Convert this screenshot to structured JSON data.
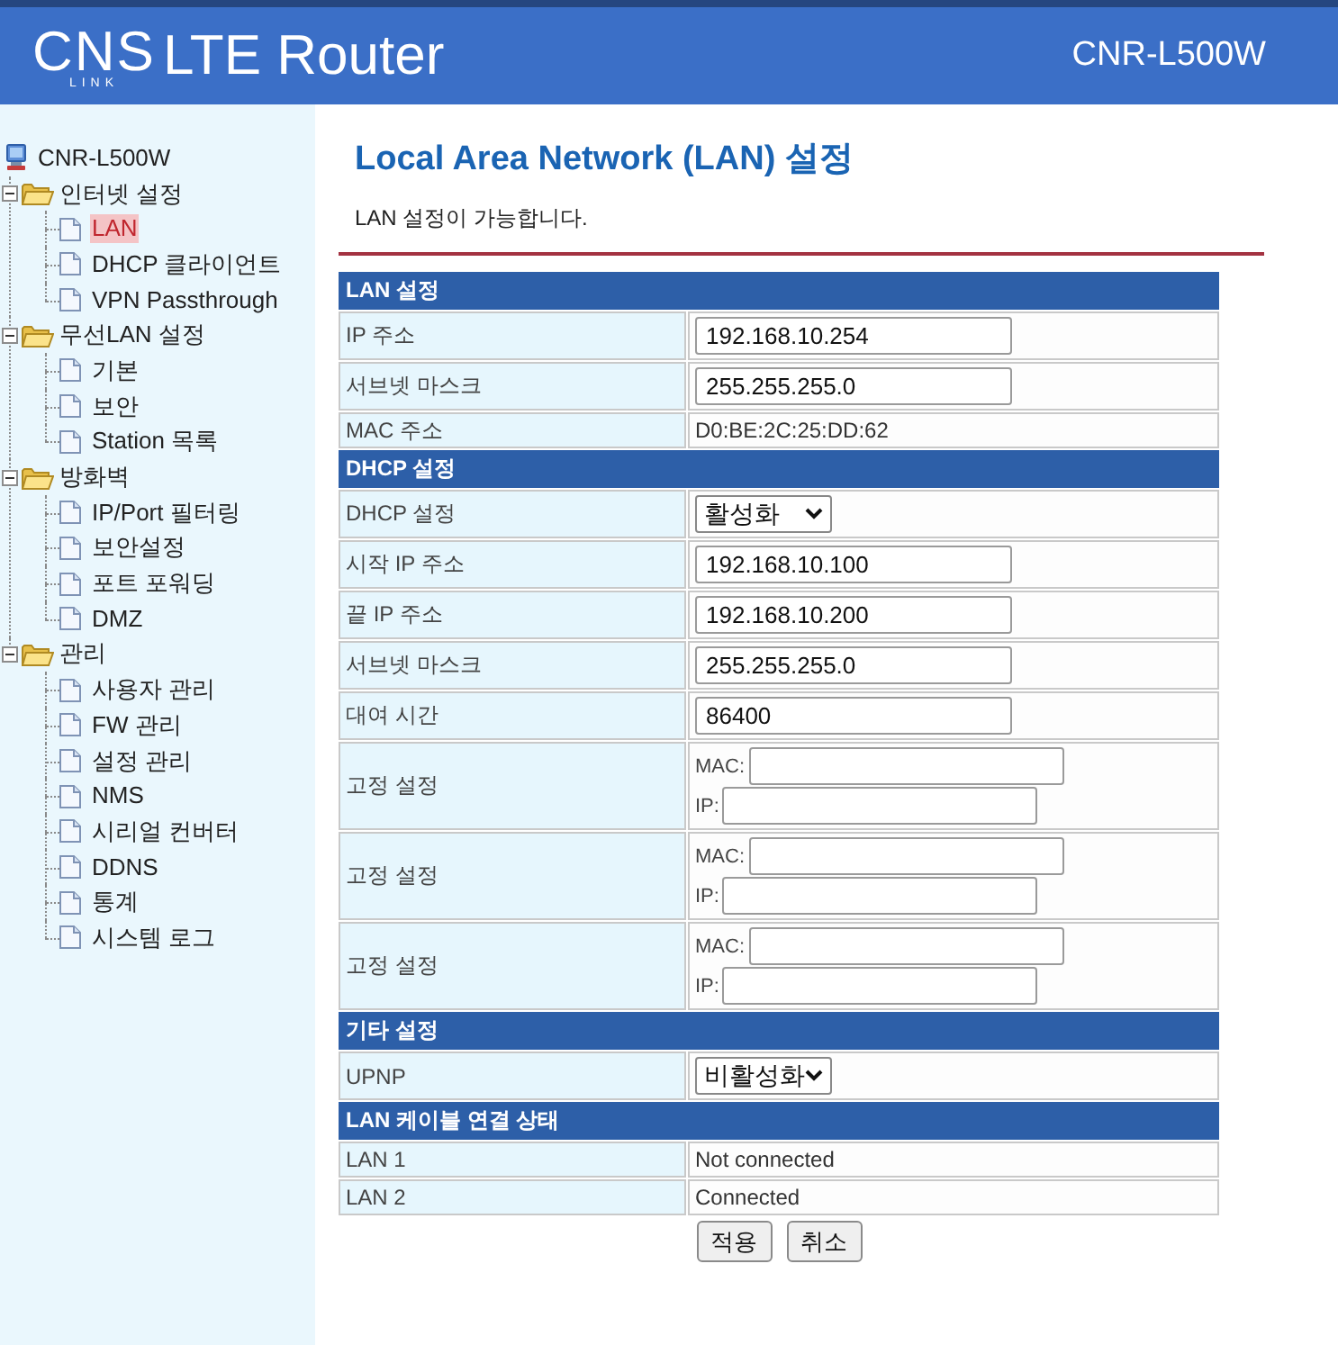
{
  "header": {
    "logo": {
      "letters": "CNS",
      "tagline": "LINK"
    },
    "title": "LTE Router",
    "model": "CNR-L500W"
  },
  "sidebar": {
    "root": {
      "label": "CNR-L500W",
      "selected": false
    },
    "items": [
      {
        "label": "인터넷 설정",
        "selected": false,
        "expanded": true,
        "children": [
          {
            "label": "LAN",
            "selected": true
          },
          {
            "label": "DHCP 클라이언트",
            "selected": false
          },
          {
            "label": "VPN Passthrough",
            "selected": false
          }
        ]
      },
      {
        "label": "무선LAN 설정",
        "selected": false,
        "expanded": true,
        "children": [
          {
            "label": "기본",
            "selected": false
          },
          {
            "label": "보안",
            "selected": false
          },
          {
            "label": "Station 목록",
            "selected": false
          }
        ]
      },
      {
        "label": "방화벽",
        "selected": false,
        "expanded": true,
        "children": [
          {
            "label": "IP/Port 필터링",
            "selected": false
          },
          {
            "label": "보안설정",
            "selected": false
          },
          {
            "label": "포트 포워딩",
            "selected": false
          },
          {
            "label": "DMZ",
            "selected": false
          }
        ]
      },
      {
        "label": "관리",
        "selected": false,
        "expanded": true,
        "children": [
          {
            "label": "사용자 관리",
            "selected": false
          },
          {
            "label": "FW 관리",
            "selected": false
          },
          {
            "label": "설정 관리",
            "selected": false
          },
          {
            "label": "NMS",
            "selected": false
          },
          {
            "label": "시리얼 컨버터",
            "selected": false
          },
          {
            "label": "DDNS",
            "selected": false
          },
          {
            "label": "통계",
            "selected": false
          },
          {
            "label": "시스템 로그",
            "selected": false
          }
        ]
      }
    ]
  },
  "page": {
    "title": "Local Area Network (LAN) 설정",
    "description": "LAN 설정이 가능합니다."
  },
  "sections": [
    {
      "title": "LAN 설정",
      "rows": [
        {
          "kind": "input",
          "label": "IP 주소",
          "value": "192.168.10.254"
        },
        {
          "kind": "input",
          "label": "서브넷 마스크",
          "value": "255.255.255.0"
        },
        {
          "kind": "text",
          "label": "MAC 주소",
          "value": "D0:BE:2C:25:DD:62"
        }
      ]
    },
    {
      "title": "DHCP 설정",
      "rows": [
        {
          "kind": "select",
          "label": "DHCP 설정",
          "value": "활성화"
        },
        {
          "kind": "input",
          "label": "시작 IP 주소",
          "value": "192.168.10.100"
        },
        {
          "kind": "input",
          "label": "끝 IP 주소",
          "value": "192.168.10.200"
        },
        {
          "kind": "input",
          "label": "서브넷 마스크",
          "value": "255.255.255.0"
        },
        {
          "kind": "input",
          "label": "대여 시간",
          "value": "86400"
        },
        {
          "kind": "static",
          "label": "고정 설정",
          "fields": [
            {
              "label": "MAC:"
            },
            {
              "label": "IP:"
            }
          ]
        },
        {
          "kind": "static",
          "label": "고정 설정",
          "fields": [
            {
              "label": "MAC:"
            },
            {
              "label": "IP:"
            }
          ]
        },
        {
          "kind": "static",
          "label": "고정 설정",
          "fields": [
            {
              "label": "MAC:"
            },
            {
              "label": "IP:"
            }
          ]
        }
      ]
    },
    {
      "title": "기타 설정",
      "rows": [
        {
          "kind": "select",
          "label": "UPNP",
          "value": "비활성화"
        }
      ]
    },
    {
      "title": "LAN 케이블 연결 상태",
      "rows": [
        {
          "kind": "text",
          "label": "LAN 1",
          "value": "Not connected"
        },
        {
          "kind": "text",
          "label": "LAN 2",
          "value": "Connected"
        }
      ]
    }
  ],
  "buttons": [
    {
      "label": "적용"
    },
    {
      "label": "취소"
    }
  ]
}
